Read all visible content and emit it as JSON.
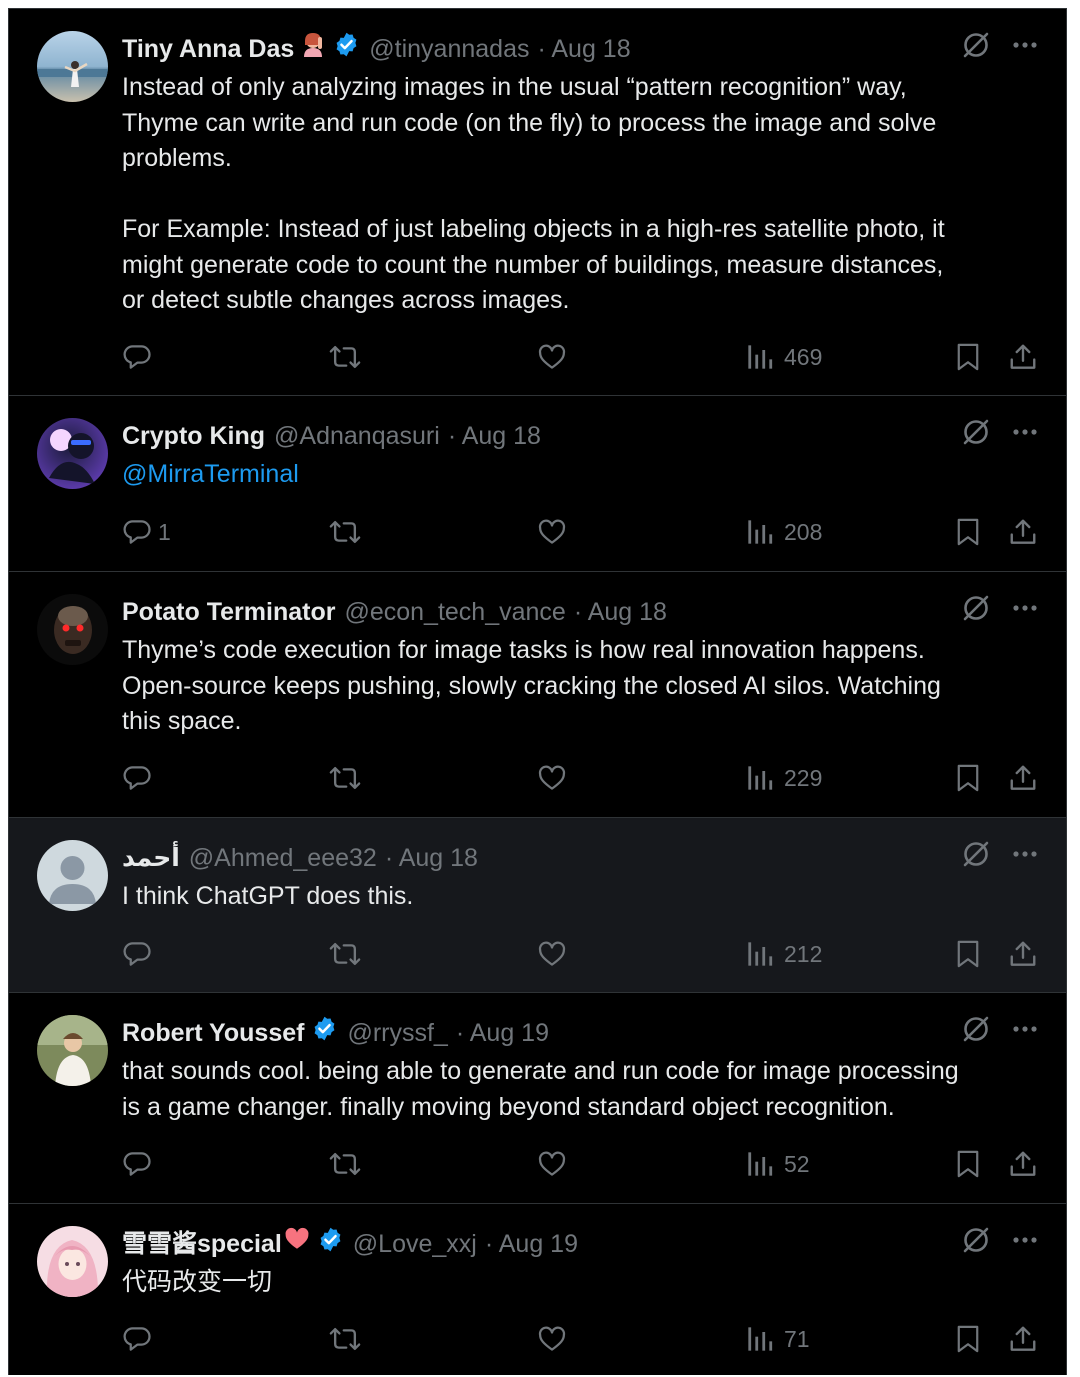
{
  "tweets": [
    {
      "name": "Tiny Anna Das",
      "has_emoji": true,
      "verified": true,
      "handle": "@tinyannadas",
      "date": "· Aug 18",
      "text": "Instead of only analyzing images in the usual “pattern recognition” way,\nThyme can write and run code (on the fly) to process the image and solve\nproblems.\n\nFor Example: Instead of just labeling objects in a high-res satellite photo, it\nmight generate code to count the number of buildings, measure distances,\nor detect subtle changes across images.",
      "reply_count": "",
      "views": "469"
    },
    {
      "name": "Crypto King",
      "has_emoji": false,
      "verified": false,
      "handle": "@Adnanqasuri",
      "date": "· Aug 18",
      "mention": "@MirraTerminal",
      "reply_count": "1",
      "views": "208"
    },
    {
      "name": "Potato Terminator",
      "has_emoji": false,
      "verified": false,
      "handle": "@econ_tech_vance",
      "date": "· Aug 18",
      "text": "Thyme’s code execution for image tasks is how real innovation happens.\nOpen-source keeps pushing, slowly cracking the closed AI silos. Watching\nthis space.",
      "reply_count": "",
      "views": "229"
    },
    {
      "name": "أحمد",
      "has_emoji": false,
      "verified": false,
      "handle": "@Ahmed_eee32",
      "date": "· Aug 18",
      "text": "I think ChatGPT does this.",
      "reply_count": "",
      "views": "212"
    },
    {
      "name": "Robert Youssef",
      "has_emoji": false,
      "verified": true,
      "handle": "@rryssf_",
      "date": "· Aug 19",
      "text": "that sounds cool. being able to generate and run code for image processing\nis a game changer. finally moving beyond standard object recognition.",
      "reply_count": "",
      "views": "52"
    },
    {
      "name": "雪雪酱special",
      "has_emoji": true,
      "verified": true,
      "handle": "@Love_xxj",
      "date": "· Aug 19",
      "text": "代码改变一切",
      "reply_count": "",
      "views": "71"
    }
  ],
  "colors": {
    "background": "#000000",
    "highlight_background": "#16181c",
    "text": "#e7e9ea",
    "muted": "#71767b",
    "link": "#1d9bf0",
    "verified": "#1d9bf0",
    "divider": "#2f3336"
  },
  "icons": [
    "verified-badge-icon",
    "grok-icon",
    "more-icon",
    "reply-icon",
    "retweet-icon",
    "like-icon",
    "views-icon",
    "bookmark-icon",
    "share-icon"
  ]
}
